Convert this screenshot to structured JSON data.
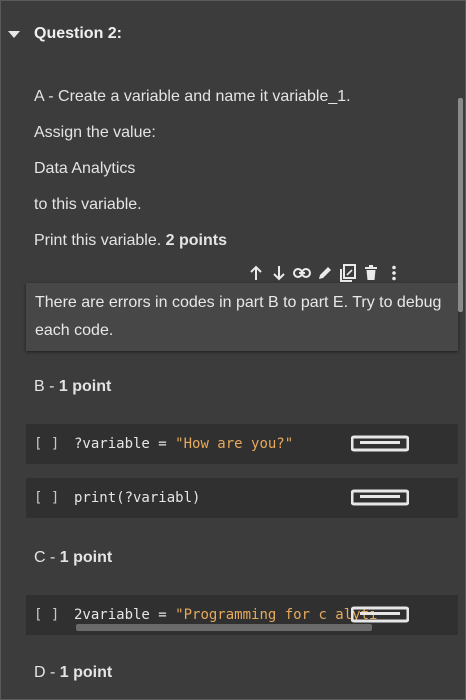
{
  "question": {
    "title": "Question 2:"
  },
  "part_a": {
    "line1": "A - Create a variable and name it variable_1.",
    "line2": "Assign the value:",
    "line3": "Data Analytics",
    "line4": "to this variable.",
    "line5_prefix": "Print this variable.",
    "line5_points": "2 points"
  },
  "toolbar": {
    "icons": [
      "arrow-up-icon",
      "arrow-down-icon",
      "link-icon",
      "pencil-icon",
      "mirror-cell-icon",
      "delete-icon",
      "more-vert-icon"
    ]
  },
  "error_note": "There are errors in codes in part B to part E. Try to debug each code.",
  "part_b": {
    "prefix": "B -",
    "points": "1 point"
  },
  "part_c": {
    "prefix": "C -",
    "points": "1 point"
  },
  "part_d": {
    "prefix": "D -",
    "points": "1 point"
  },
  "cells": [
    {
      "bracket": "[ ]",
      "code": "?variable = ",
      "string": "\"How are you?\""
    },
    {
      "bracket": "[ ]",
      "code": "print(?variabl)",
      "string": ""
    },
    {
      "bracket": "[ ]",
      "code": "2variable = ",
      "string": "\"Programming for c   alyti"
    }
  ],
  "colors": {
    "background": "#3c3c3c",
    "code_bg": "#303030",
    "string": "#e6a95c"
  }
}
